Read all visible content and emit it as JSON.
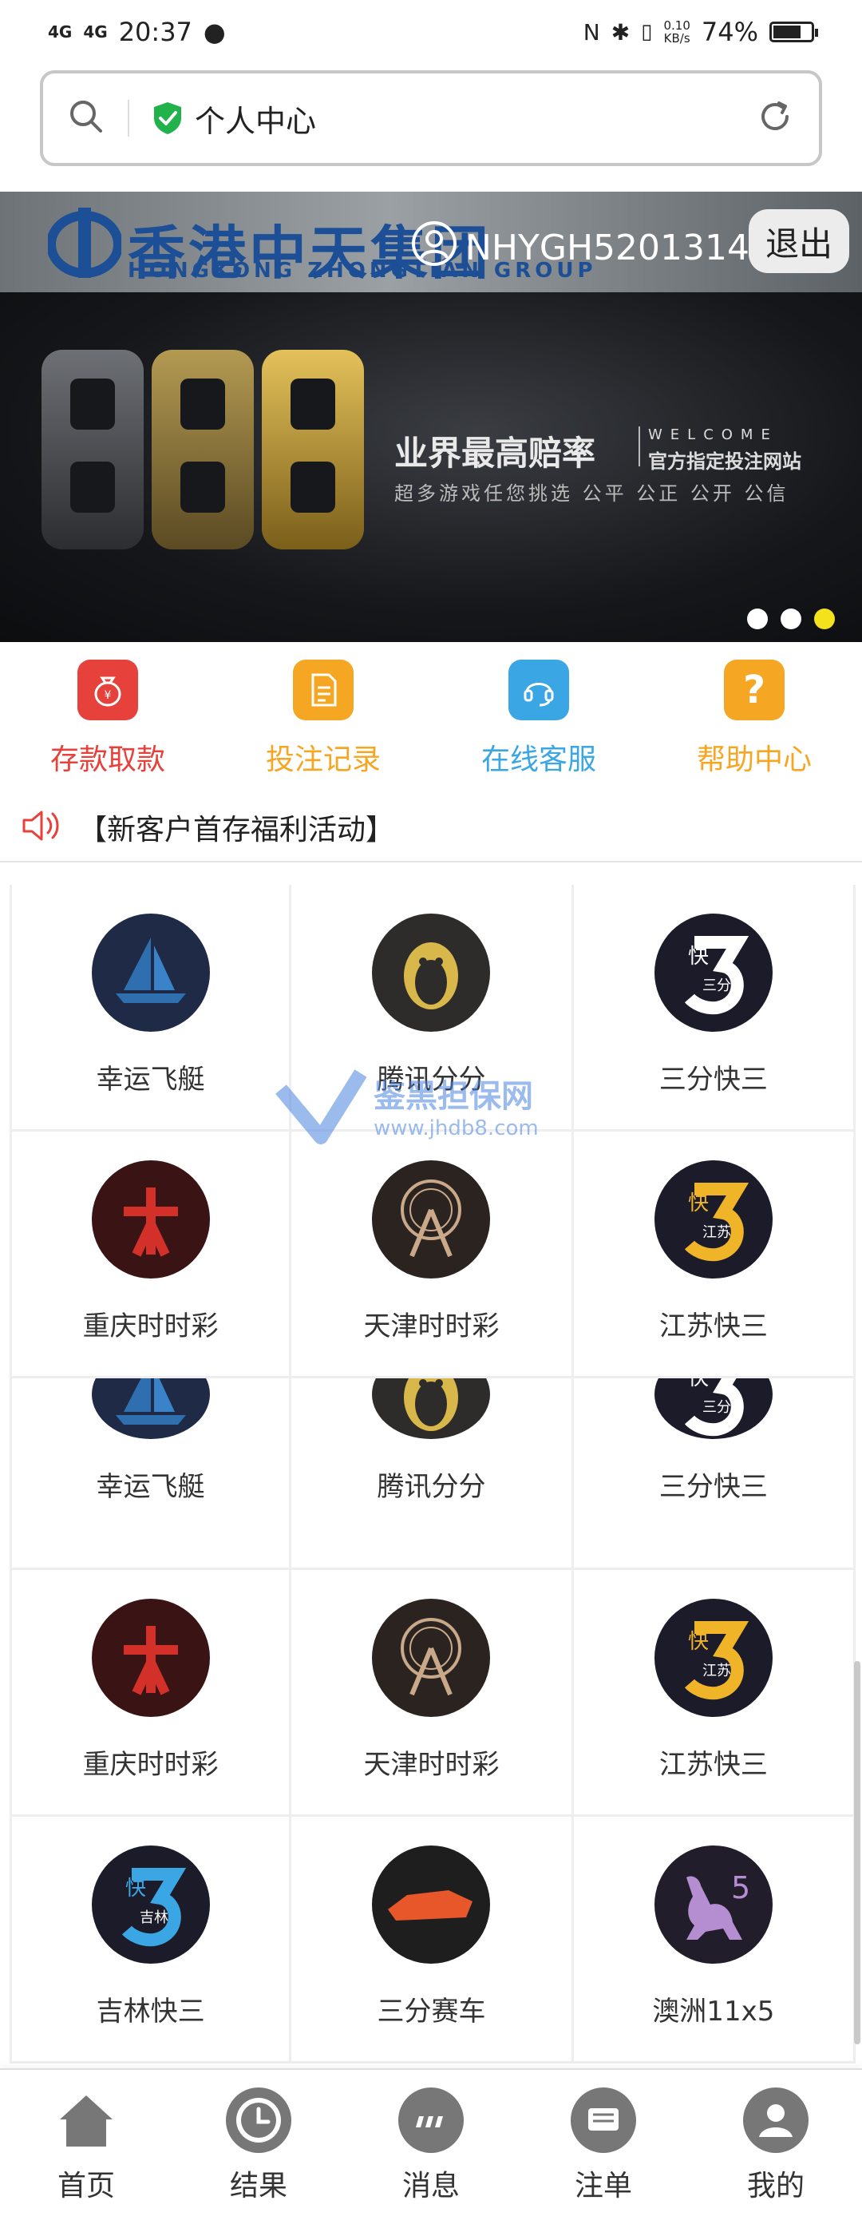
{
  "status_bar": {
    "network1": "4G",
    "network2": "4G",
    "time": "20:37",
    "speed_value": "0.10",
    "speed_unit": "KB/s",
    "battery": "74%",
    "battery_level": 74
  },
  "address_bar": {
    "title": "个人中心"
  },
  "header": {
    "brand": "香港中天集团",
    "brand_en": "HONGKONG ZHONGTIAN GROUP",
    "username": "NHYGH5201314",
    "logout_label": "退出"
  },
  "banner": {
    "headline": "业界最高赔率",
    "welcome": "WELCOME",
    "site": "官方指定投注网站",
    "slogan": "超多游戏任您挑选 公平 公正 公开 公信",
    "active_slide": 3,
    "slide_count": 3
  },
  "quick_nav": [
    {
      "label": "存款取款",
      "color": "#e6413b",
      "icon": "money-bag-icon"
    },
    {
      "label": "投注记录",
      "color": "#f5a623",
      "icon": "document-icon"
    },
    {
      "label": "在线客服",
      "color": "#3aa7e4",
      "icon": "headset-icon"
    },
    {
      "label": "帮助中心",
      "color": "#f5a623",
      "icon": "question-icon"
    }
  ],
  "notice": {
    "text": "【新客户首存福利活动】"
  },
  "games": [
    {
      "name": "幸运飞艇",
      "icon": "sailboat-icon",
      "bg": "#1e2a46"
    },
    {
      "name": "腾讯分分",
      "icon": "penguin-icon",
      "bg": "#2e2c2a"
    },
    {
      "name": "三分快三",
      "icon": "k3-icon",
      "bg": "#1b1b2a"
    },
    {
      "name": "重庆时时彩",
      "icon": "chongqing-icon",
      "bg": "#3a1414"
    },
    {
      "name": "天津时时彩",
      "icon": "ferris-wheel-icon",
      "bg": "#2a2320"
    },
    {
      "name": "江苏快三",
      "icon": "k3-jiangsu-icon",
      "bg": "#1b1b2a"
    },
    {
      "name": "幸运飞艇",
      "icon": "sailboat-icon",
      "bg": "#1e2a46"
    },
    {
      "name": "腾讯分分",
      "icon": "penguin-icon",
      "bg": "#2e2c2a"
    },
    {
      "name": "三分快三",
      "icon": "k3-icon",
      "bg": "#1b1b2a"
    },
    {
      "name": "重庆时时彩",
      "icon": "chongqing-icon",
      "bg": "#3a1414"
    },
    {
      "name": "天津时时彩",
      "icon": "ferris-wheel-icon",
      "bg": "#2a2320"
    },
    {
      "name": "江苏快三",
      "icon": "k3-jiangsu-icon",
      "bg": "#1b1b2a"
    },
    {
      "name": "吉林快三",
      "icon": "k3-jilin-icon",
      "bg": "#1b1b2a"
    },
    {
      "name": "三分赛车",
      "icon": "race-car-icon",
      "bg": "#1e1e1e"
    },
    {
      "name": "澳洲11x5",
      "icon": "kangaroo-icon",
      "bg": "#221d2a"
    }
  ],
  "game_badges": {
    "k3": "快",
    "three_min": "三分",
    "jiangsu": "江苏",
    "jilin": "吉林",
    "au_number": "5"
  },
  "watermark": {
    "text": "鉴黑担保网",
    "url": "www.jhdb8.com"
  },
  "tabs": [
    {
      "label": "首页",
      "icon": "home-icon"
    },
    {
      "label": "结果",
      "icon": "clock-icon"
    },
    {
      "label": "消息",
      "icon": "chat-icon"
    },
    {
      "label": "注单",
      "icon": "message-list-icon"
    },
    {
      "label": "我的",
      "icon": "user-icon"
    }
  ]
}
